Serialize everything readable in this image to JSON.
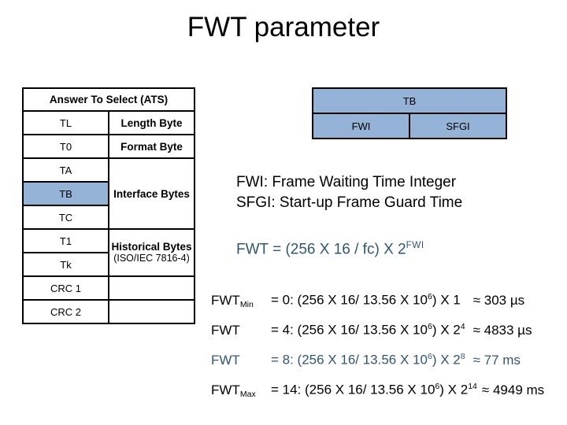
{
  "slide": {
    "title": "FWT parameter"
  },
  "ats_table": {
    "header": "Answer To Select (ATS)",
    "rows": [
      {
        "label": "TL",
        "value": "Length Byte"
      },
      {
        "label": "T0",
        "value": "Format Byte"
      },
      {
        "label": "TA",
        "value": ""
      },
      {
        "label": "TB",
        "value": "Interface Bytes"
      },
      {
        "label": "TC",
        "value": ""
      },
      {
        "label": "T1",
        "value": "Historical Bytes"
      },
      {
        "label": "Tk",
        "value": "(ISO/IEC 7816-4)"
      },
      {
        "label": "CRC 1",
        "value": ""
      },
      {
        "label": "CRC 2",
        "value": ""
      }
    ],
    "interface_bytes_label": "Interface Bytes",
    "historical_line1": "Historical Bytes",
    "historical_line2": "(ISO/IEC 7816-4)",
    "highlight_color": "#95b3d7"
  },
  "tb_table": {
    "header": "TB",
    "left_cell": "FWI",
    "right_cell": "SFGI",
    "fill_color": "#95b3d7"
  },
  "definitions": {
    "line1": "FWI: Frame Waiting Time Integer",
    "line2": "SFGI: Start-up Frame Guard Time"
  },
  "formula": {
    "base": "FWT = (256 X 16 / fc) X 2",
    "exponent": "FWI",
    "color": "#31566f"
  },
  "equations": [
    {
      "name": "FWT",
      "subscript": "Min",
      "body_pre": "= 0: (256 X 16/ 13.56 X 10",
      "body_sup": "6",
      "body_post": ") X 1",
      "approx": "≈  303 µs",
      "color": "#000000"
    },
    {
      "name": "FWT",
      "subscript": "",
      "body_pre": "= 4: (256 X 16/ 13.56 X 10",
      "body_sup": "6",
      "body_post": ") X 2",
      "body_sup2": "4",
      "approx": "≈ 4833 µs",
      "color": "#000000"
    },
    {
      "name": "FWT",
      "subscript": "",
      "body_pre": "= 8: (256 X 16/ 13.56 X 10",
      "body_sup": "6",
      "body_post": ") X 2",
      "body_sup2": "8",
      "approx": "≈ 77 ms",
      "color": "#31566f"
    },
    {
      "name": "FWT",
      "subscript": "Max",
      "body_pre": "= 14: (256 X 16/ 13.56 X 10",
      "body_sup": "6",
      "body_post": ") X 2",
      "body_sup2": "14",
      "approx": "≈ 4949 ms",
      "color": "#000000"
    }
  ]
}
